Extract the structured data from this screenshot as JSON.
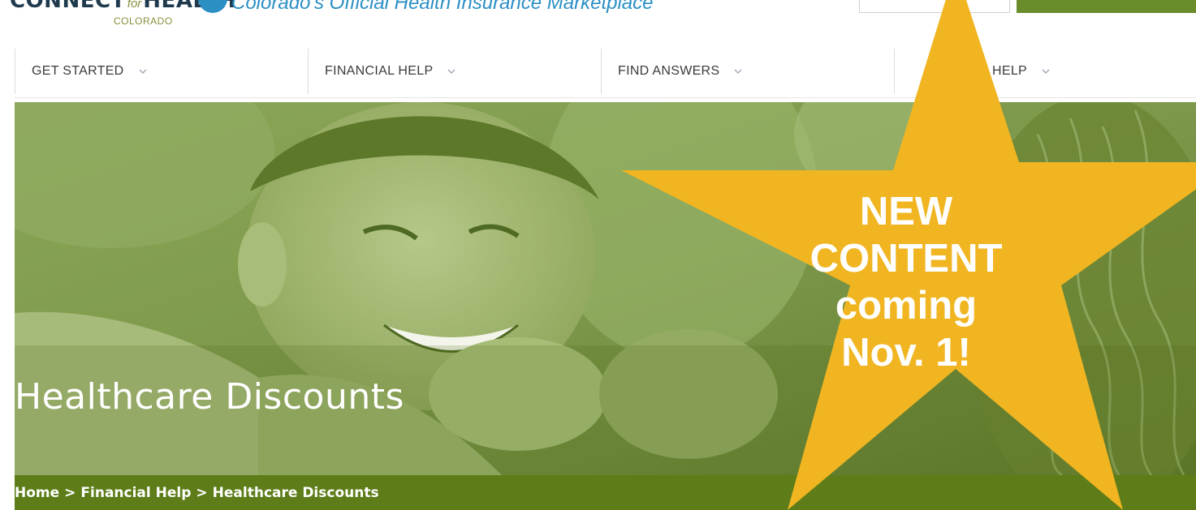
{
  "header": {
    "logo": {
      "main_left": "CONNECT",
      "main_mid": "for",
      "main_right": "HEALTH",
      "sub": "COLORADO"
    },
    "tagline": "Colorado's Official Health Insurance Marketplace"
  },
  "nav": {
    "items": [
      {
        "label": "GET STARTED"
      },
      {
        "label": "FINANCIAL HELP"
      },
      {
        "label": "FIND ANSWERS"
      },
      {
        "label": "HELP"
      }
    ]
  },
  "hero": {
    "title": "Healthcare Discounts"
  },
  "breadcrumb": {
    "home": "Home",
    "sep": ">",
    "level1": "Financial Help",
    "current": "Healthcare Discounts"
  },
  "callout": {
    "line1": "NEW",
    "line2": "CONTENT",
    "line3": "coming",
    "line4": "Nov. 1!",
    "color": "#f0b521"
  },
  "colors": {
    "brand_green": "#5e7d19",
    "hero_tint": "#7f9a46",
    "brand_blue": "#2b8fc4"
  }
}
